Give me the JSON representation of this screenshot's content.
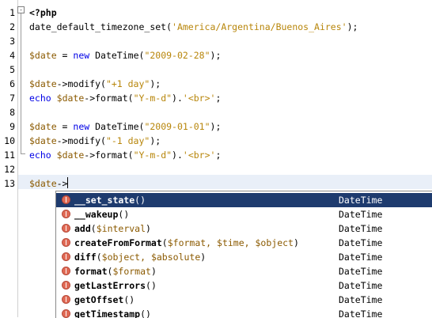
{
  "editor": {
    "line_numbers": [
      "1",
      "2",
      "3",
      "4",
      "5",
      "6",
      "7",
      "8",
      "9",
      "10",
      "11",
      "12",
      "13"
    ],
    "lines": [
      [
        {
          "t": "<?php",
          "c": "bold"
        }
      ],
      [
        {
          "t": "date_default_timezone_set(",
          "c": ""
        },
        {
          "t": "'America/Argentina/Buenos_Aires'",
          "c": "str"
        },
        {
          "t": ");",
          "c": ""
        }
      ],
      [],
      [
        {
          "t": "$date",
          "c": "var"
        },
        {
          "t": " = ",
          "c": ""
        },
        {
          "t": "new",
          "c": "kw"
        },
        {
          "t": " DateTime(",
          "c": ""
        },
        {
          "t": "\"2009-02-28\"",
          "c": "str"
        },
        {
          "t": ");",
          "c": ""
        }
      ],
      [],
      [
        {
          "t": "$date",
          "c": "var"
        },
        {
          "t": "->modify(",
          "c": ""
        },
        {
          "t": "\"+1 day\"",
          "c": "str"
        },
        {
          "t": ");",
          "c": ""
        }
      ],
      [
        {
          "t": "echo",
          "c": "kw"
        },
        {
          "t": " ",
          "c": ""
        },
        {
          "t": "$date",
          "c": "var"
        },
        {
          "t": "->format(",
          "c": ""
        },
        {
          "t": "\"Y-m-d\"",
          "c": "str"
        },
        {
          "t": ").",
          "c": ""
        },
        {
          "t": "'<br>'",
          "c": "str"
        },
        {
          "t": ";",
          "c": ""
        }
      ],
      [],
      [
        {
          "t": "$date",
          "c": "var"
        },
        {
          "t": " = ",
          "c": ""
        },
        {
          "t": "new",
          "c": "kw"
        },
        {
          "t": " DateTime(",
          "c": ""
        },
        {
          "t": "\"2009-01-01\"",
          "c": "str"
        },
        {
          "t": ");",
          "c": ""
        }
      ],
      [
        {
          "t": "$date",
          "c": "var"
        },
        {
          "t": "->modify(",
          "c": ""
        },
        {
          "t": "\"-1 day\"",
          "c": "str"
        },
        {
          "t": ");",
          "c": ""
        }
      ],
      [
        {
          "t": "echo",
          "c": "kw"
        },
        {
          "t": " ",
          "c": ""
        },
        {
          "t": "$date",
          "c": "var"
        },
        {
          "t": "->format(",
          "c": ""
        },
        {
          "t": "\"Y-m-d\"",
          "c": "str"
        },
        {
          "t": ").",
          "c": ""
        },
        {
          "t": "'<br>'",
          "c": "str"
        },
        {
          "t": ";",
          "c": ""
        }
      ],
      [],
      [
        {
          "t": "$date",
          "c": "var"
        },
        {
          "t": "->",
          "c": ""
        }
      ]
    ],
    "fold_glyph": "-"
  },
  "completion": {
    "items": [
      {
        "name": "__set_state",
        "params": "",
        "class": "DateTime",
        "selected": true
      },
      {
        "name": "__wakeup",
        "params": "",
        "class": "DateTime",
        "selected": false
      },
      {
        "name": "add",
        "params": "$interval",
        "class": "DateTime",
        "selected": false
      },
      {
        "name": "createFromFormat",
        "params": "$format, $time, $object",
        "class": "DateTime",
        "selected": false
      },
      {
        "name": "diff",
        "params": "$object, $absolute",
        "class": "DateTime",
        "selected": false
      },
      {
        "name": "format",
        "params": "$format",
        "class": "DateTime",
        "selected": false
      },
      {
        "name": "getLastErrors",
        "params": "",
        "class": "DateTime",
        "selected": false
      },
      {
        "name": "getOffset",
        "params": "",
        "class": "DateTime",
        "selected": false
      },
      {
        "name": "getTimestamp",
        "params": "",
        "class": "DateTime",
        "selected": false
      }
    ],
    "icon": "method-icon",
    "colors": {
      "selected_bg": "#1e3b6e",
      "param": "#8b5a00",
      "icon": "#e06a55"
    }
  }
}
